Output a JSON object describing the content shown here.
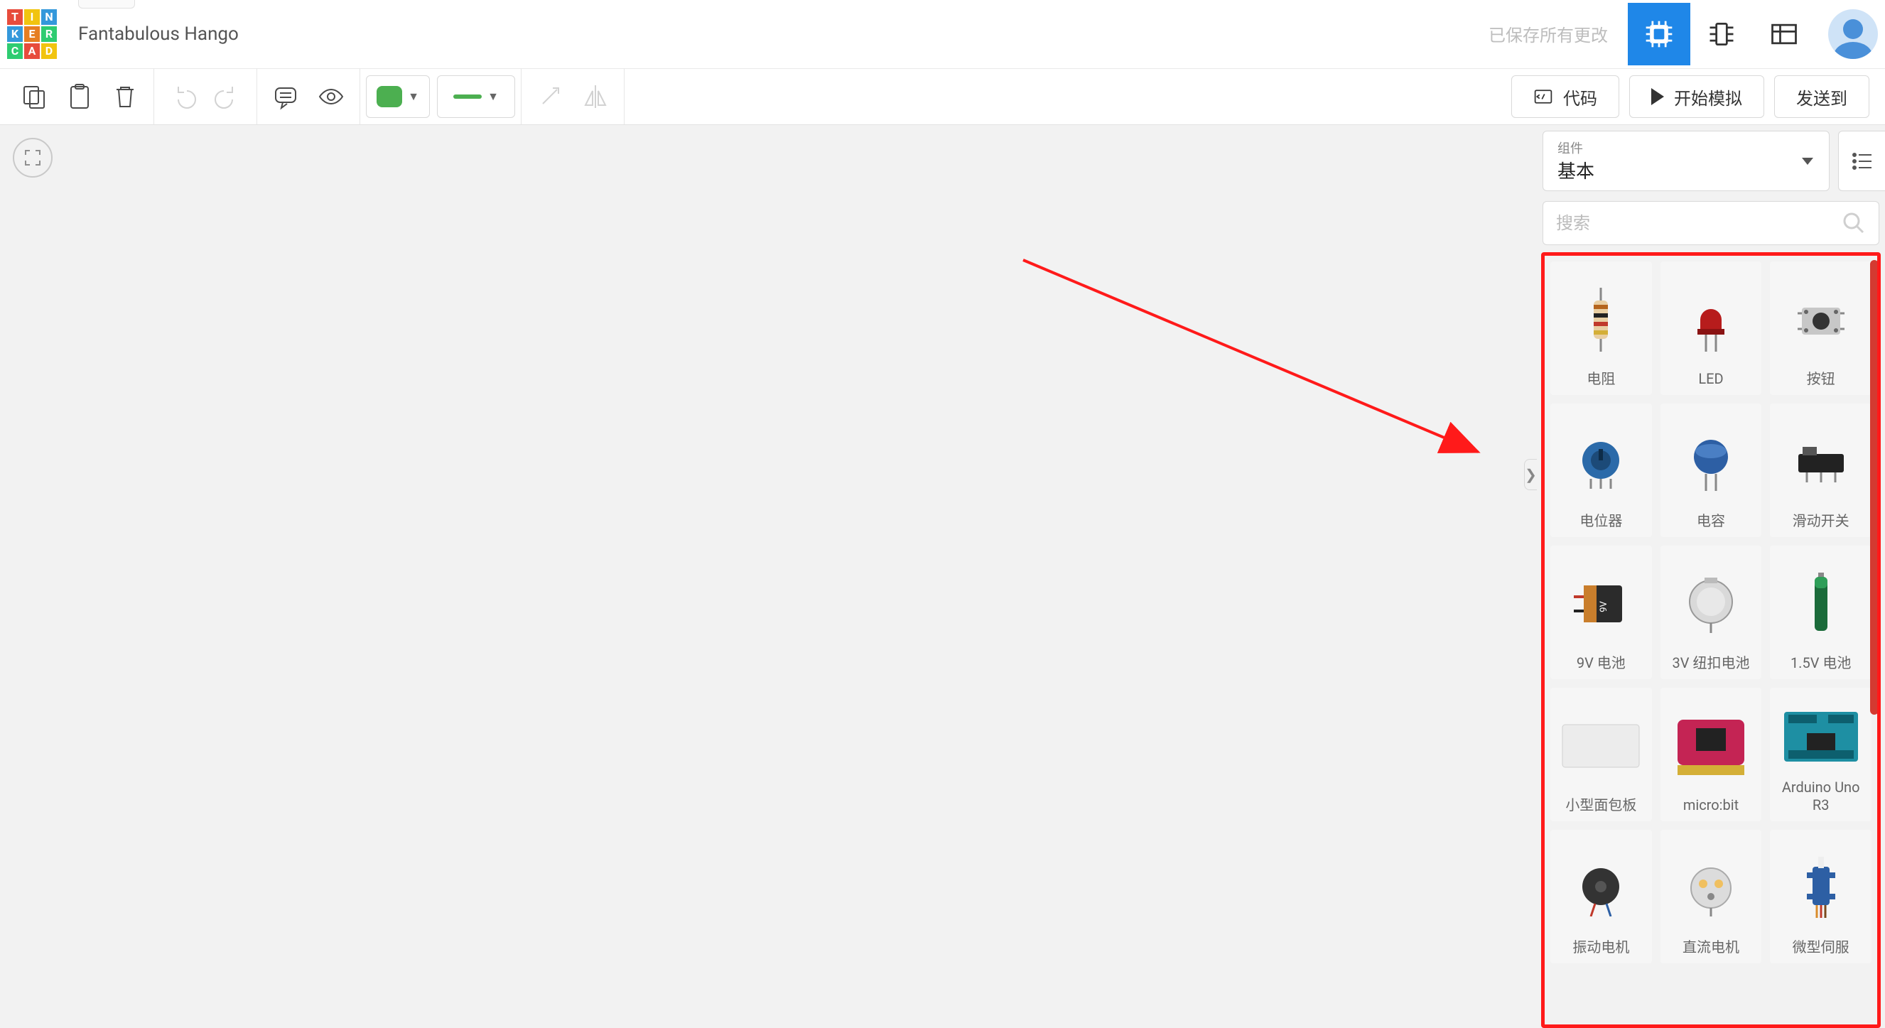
{
  "header": {
    "logo_letters": [
      "T",
      "I",
      "N",
      "K",
      "E",
      "R",
      "C",
      "A",
      "D"
    ],
    "project_title": "Fantabulous Hango",
    "save_status": "已保存所有更改"
  },
  "top_icons": {
    "chip": "chip-icon",
    "ic": "ic-icon",
    "schematic": "schematic-icon",
    "avatar": "user-avatar"
  },
  "toolbar": {
    "code_label": "代码",
    "simulate_label": "开始模拟",
    "send_label": "发送到"
  },
  "sidebar": {
    "category_small": "组件",
    "category_value": "基本",
    "search_placeholder": "搜索",
    "parts": [
      {
        "label": "电阻",
        "key": "resistor"
      },
      {
        "label": "LED",
        "key": "led"
      },
      {
        "label": "按钮",
        "key": "pushbutton"
      },
      {
        "label": "电位器",
        "key": "potentiometer"
      },
      {
        "label": "电容",
        "key": "capacitor"
      },
      {
        "label": "滑动开关",
        "key": "slide-switch"
      },
      {
        "label": "9V 电池",
        "key": "9v-battery"
      },
      {
        "label": "3V 纽扣电池",
        "key": "coin-cell"
      },
      {
        "label": "1.5V 电池",
        "key": "aa-battery"
      },
      {
        "label": "小型面包板",
        "key": "breadboard"
      },
      {
        "label": "micro:bit",
        "key": "microbit"
      },
      {
        "label": "Arduino Uno R3",
        "key": "arduino"
      },
      {
        "label": "振动电机",
        "key": "vibration-motor"
      },
      {
        "label": "直流电机",
        "key": "dc-motor"
      },
      {
        "label": "微型伺服",
        "key": "micro-servo"
      }
    ]
  }
}
